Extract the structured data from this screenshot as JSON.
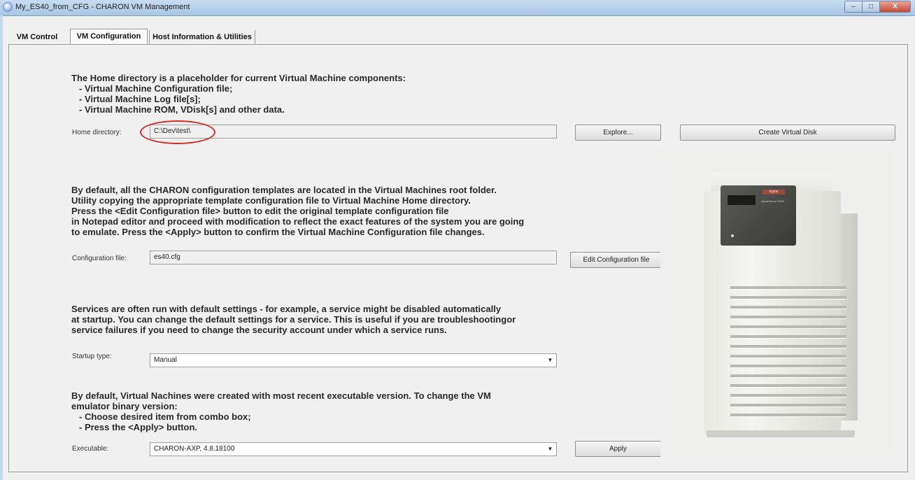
{
  "window": {
    "title": "My_ES40_from_CFG - CHARON VM Management",
    "min_glyph": "–",
    "max_glyph": "□",
    "close_glyph": "X"
  },
  "tabs": [
    {
      "label": "VM Control",
      "active": false
    },
    {
      "label": "VM Configuration",
      "active": true
    },
    {
      "label": "Host Information & Utilities",
      "active": false
    }
  ],
  "home": {
    "description": [
      "The Home directory is a placeholder for current Virtual Machine components:",
      "- Virtual Machine Configuration file;",
      "- Virtual Machine Log file[s];",
      "- Virtual Machine ROM, VDisk[s] and other data."
    ],
    "label": "Home directory:",
    "value": "C:\\Dev\\test\\",
    "explore_button": "Explore...",
    "create_disk_button": "Create Virtual Disk"
  },
  "config": {
    "description": [
      "By default, all the CHARON configuration templates are located in the Virtual Machines root folder.",
      "Utility copying the appropriate template configuration file to Virtual Machine Home directory.",
      "Press the <Edit Configuration file> button to edit the original template configuration file",
      "in Notepad editor and proceed with modification to reflect the exact features of the system you are going",
      "to emulate. Press the <Apply> button to confirm the Virtual Machine Configuration file changes."
    ],
    "label": "Configuration file:",
    "value": "es40.cfg",
    "edit_button": "Edit Configuration file"
  },
  "services": {
    "description": [
      "Services are often run with default settings - for example, a service might be disabled automatically",
      "at startup. You can change the default settings for a service. This is useful if you are troubleshootingor",
      "service failures if you need to change the security account under which a service runs."
    ],
    "label": "Startup type:",
    "value": "Manual"
  },
  "executable": {
    "description": [
      "By default, Virtual Nachines were created with most recent executable version. To change the VM",
      "emulator binary version:",
      "- Choose desired item from combo box;",
      "- Press the <Apply> button."
    ],
    "label": "Executable:",
    "value": "CHARON-AXP, 4.8.18100",
    "apply_button": "Apply"
  },
  "dropdown_arrow": "▼",
  "server_image": {
    "brand_text": "digital",
    "model_text": "AlphaServer ES40"
  },
  "colors": {
    "highlight_circle": "#d62b2b",
    "titlebar": "#b9d1ea",
    "panel_bg": "#f0f0f0"
  }
}
